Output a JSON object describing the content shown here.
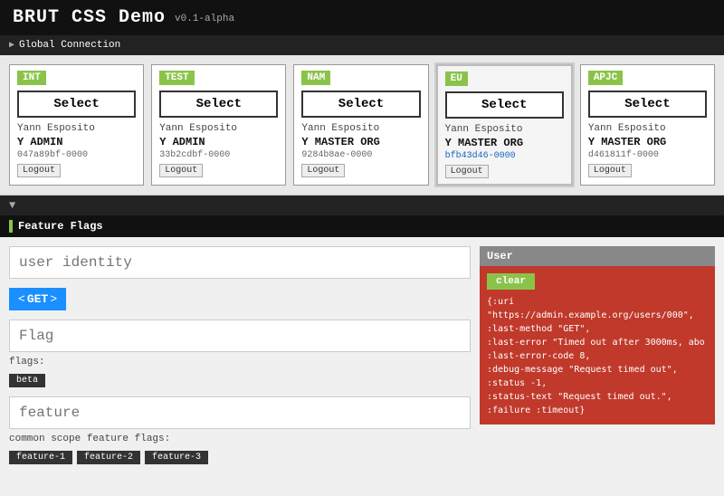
{
  "header": {
    "app_title": "BRUT CSS Demo",
    "version": "v0.1-alpha"
  },
  "global_connection": {
    "label": "Global Connection",
    "arrow": "▶"
  },
  "regions": [
    {
      "id": "INT",
      "label": "INT",
      "select_label": "Select",
      "user_name": "Yann Esposito",
      "role": "Y ADMIN",
      "uuid": "047a89bf-0000",
      "logout_label": "Logout",
      "selected": false
    },
    {
      "id": "TEST",
      "label": "TEST",
      "select_label": "Select",
      "user_name": "Yann Esposito",
      "role": "Y ADMIN",
      "uuid": "33b2cdbf-0000",
      "logout_label": "Logout",
      "selected": false
    },
    {
      "id": "NAM",
      "label": "NAM",
      "select_label": "Select",
      "user_name": "Yann Esposito",
      "role": "Y MASTER ORG",
      "uuid": "9284b8ae-0000",
      "logout_label": "Logout",
      "selected": false
    },
    {
      "id": "EU",
      "label": "EU",
      "select_label": "Select",
      "user_name": "Yann Esposito",
      "role": "Y MASTER ORG",
      "uuid": "bfb43d46-0000",
      "logout_label": "Logout",
      "selected": true
    },
    {
      "id": "APJC",
      "label": "APJC",
      "select_label": "Select",
      "user_name": "Yann Esposito",
      "role": "Y MASTER ORG",
      "uuid": "d461811f-0000",
      "logout_label": "Logout",
      "selected": false
    }
  ],
  "dropdown_arrow": "▼",
  "feature_flags": {
    "section_label": "Feature Flags",
    "identity_placeholder": "user identity",
    "get_label": "GET",
    "flag_placeholder": "Flag",
    "flags_label": "flags:",
    "beta_tag": "beta",
    "feature_placeholder": "feature",
    "common_scope_label": "common scope feature flags:",
    "feature_tags": [
      "feature-1",
      "feature-2",
      "feature-3"
    ]
  },
  "user_panel": {
    "header_label": "User",
    "clear_label": "clear",
    "error_text": "{:uri\n\"https://admin.example.org/users/000\",\n:last-method \"GET\",\n:last-error \"Timed out after 3000ms, abo\n:last-error-code 8,\n:debug-message \"Request timed out\",\n:status -1,\n:status-text \"Request timed out.\",\n:failure :timeout}"
  }
}
